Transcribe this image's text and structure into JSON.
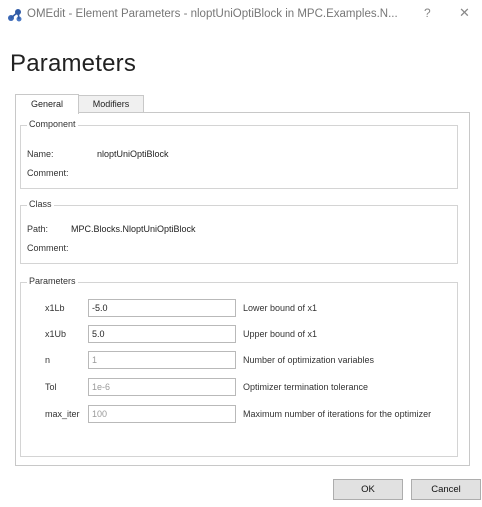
{
  "window": {
    "title": "OMEdit - Element Parameters - nloptUniOptiBlock in MPC.Examples.N...",
    "help_label": "?",
    "close_label": "✕",
    "icon": "omedit-app-icon"
  },
  "heading": "Parameters",
  "tabs": [
    {
      "label": "General",
      "active": true
    },
    {
      "label": "Modifiers",
      "active": false
    }
  ],
  "component": {
    "group_title": "Component",
    "name_label": "Name:",
    "name_value": "nloptUniOptiBlock",
    "comment_label": "Comment:"
  },
  "class": {
    "group_title": "Class",
    "path_label": "Path:",
    "path_value": "MPC.Blocks.NloptUniOptiBlock",
    "comment_label": "Comment:"
  },
  "parameters": {
    "group_title": "Parameters",
    "rows": [
      {
        "name": "x1Lb",
        "value": "-5.0",
        "placeholder": false,
        "description": "Lower bound of x1"
      },
      {
        "name": "x1Ub",
        "value": "5.0",
        "placeholder": false,
        "description": "Upper bound of x1"
      },
      {
        "name": "n",
        "value": "1",
        "placeholder": true,
        "description": "Number of optimization variables"
      },
      {
        "name": "Tol",
        "value": "1e-6",
        "placeholder": true,
        "description": "Optimizer termination tolerance"
      },
      {
        "name": "max_iter",
        "value": "100",
        "placeholder": true,
        "description": "Maximum number of iterations for the optimizer"
      }
    ]
  },
  "buttons": {
    "ok": "OK",
    "cancel": "Cancel"
  },
  "colors": {
    "border": "#c8c8c8",
    "button_bg": "#e1e1e1",
    "placeholder_text": "#9a9a9a"
  }
}
